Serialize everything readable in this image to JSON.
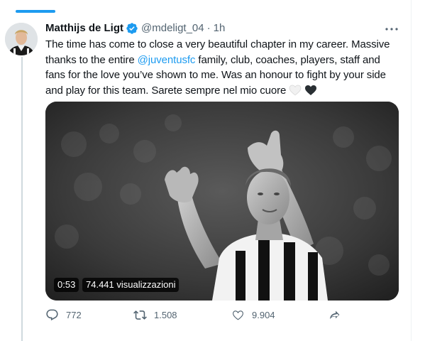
{
  "tweet": {
    "author_name": "Matthijs de Ligt",
    "handle": "@mdeligt_04",
    "separator": "·",
    "time": "1h",
    "text_line1": "The time has come to close a very beautiful chapter in my career. Massive",
    "text_line2_pre": "thanks to the entire ",
    "mention": "@juventusfc",
    "text_line2_post": " family, club, coaches, players, staff and",
    "text_line3": "fans for the love you’ve shown to me. Was an honour to fight by your side",
    "text_line4": "and play for this team. Sarete sempre nel mio cuore"
  },
  "media": {
    "duration": "0:53",
    "views": "74.441 visualizzazioni"
  },
  "actions": {
    "replies": "772",
    "retweets": "1.508",
    "likes": "9.904"
  },
  "colors": {
    "accent": "#1d9bf0",
    "text": "#0f1419",
    "secondary": "#536471"
  },
  "icons": {
    "verified": "verified-badge-icon",
    "more": "more-dots-icon",
    "reply": "reply-icon",
    "retweet": "retweet-icon",
    "like": "heart-icon",
    "share": "share-icon"
  }
}
